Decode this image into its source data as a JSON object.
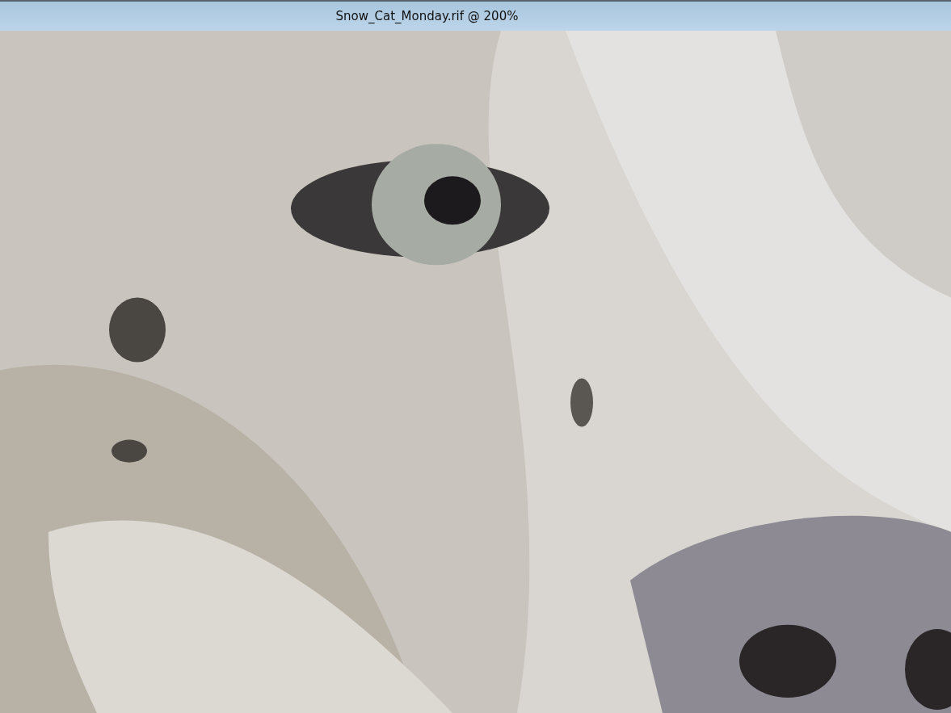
{
  "window": {
    "title": "Snow_Cat_Monday.rif @ 200%"
  }
}
